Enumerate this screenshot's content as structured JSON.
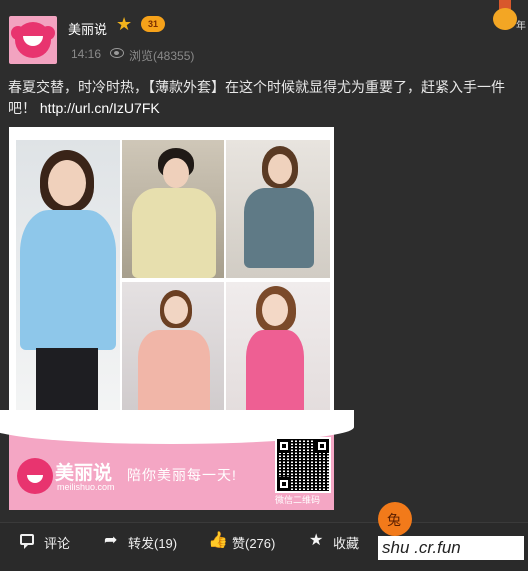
{
  "post": {
    "author": "美丽说",
    "time": "14:16",
    "views_label": "浏览",
    "views_count": "(48355)",
    "vip_level": "31",
    "year_badge": "年",
    "text": "春夏交替，时冷时热，【薄款外套】在这个时候就显得尤为重要了，赶紧入手一件吧！",
    "link": "http://url.cn/IzU7FK"
  },
  "image": {
    "brand_name": "美丽说",
    "brand_url": "meilishuo.com",
    "slogan": "陪你美丽每一天!",
    "qr_label": "微信二维码"
  },
  "actions": {
    "comment": "评论",
    "repost": "转发(19)",
    "like": "赞(276)",
    "favorite": "收藏"
  },
  "watermark": {
    "site_text": "shu .cr.fun"
  },
  "colors": {
    "background": "#2d2d2d",
    "accent_pink": "#e8346f",
    "badge_orange": "#f6a21a"
  }
}
